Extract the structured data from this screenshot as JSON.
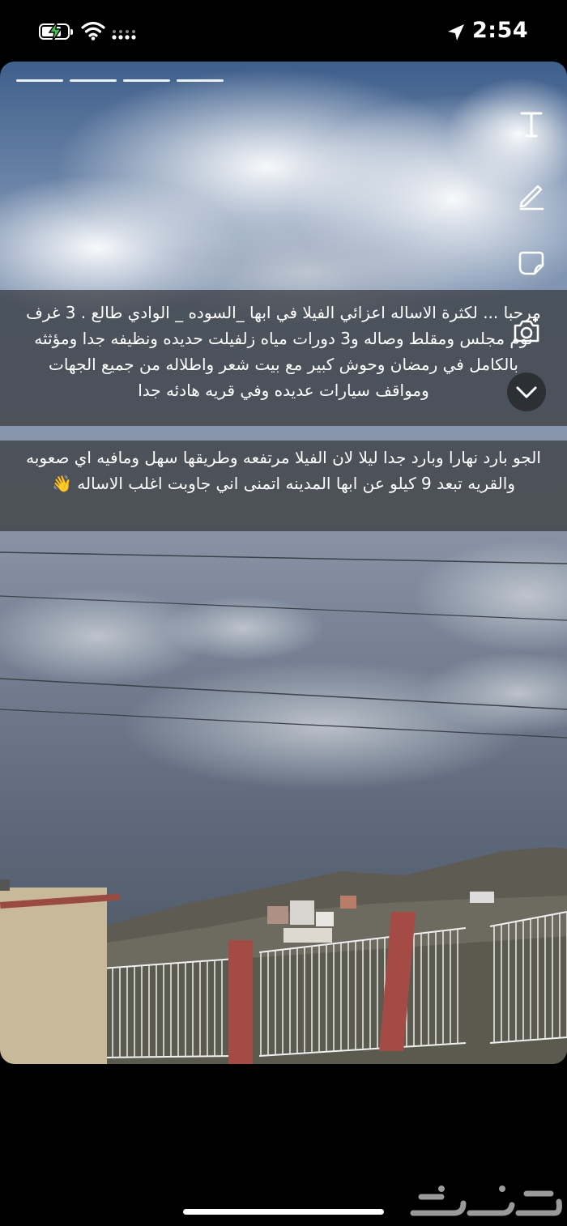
{
  "status_bar": {
    "time": "2:54",
    "battery_level": 0.75
  },
  "story": {
    "segments": 4,
    "caption_1": "مرحبا ... لكثرة الاساله اعزائي الفيلا في ابها _السوده _ الوادي طالع . 3 غرف نوم مجلس ومقلط وصاله و3 دورات مياه زلفيلت حديده ونظيفه جدا ومؤثثه بالكامل في رمضان وحوش كبير مع بيت شعر واطلاله من جميع الجهات ومواقف سيارات عديده وفي قريه هادئه جدا",
    "caption_2": "الجو بارد نهارا وبارد جدا ليلا لان الفيلا مرتفعه وطريقها سهل ومافيه اي صعوبه والقريه تبعد 9 كيلو عن ابها المدينه اتمنى اني جاوبت اغلب الاساله 👋"
  },
  "icons": {
    "text_tool": "text-tool-icon",
    "draw_tool": "pencil-icon",
    "sticker_tool": "sticker-icon",
    "camera": "camera-icon",
    "collapse": "chevron-down-icon"
  },
  "brand": {
    "logo_text": "حراج"
  }
}
